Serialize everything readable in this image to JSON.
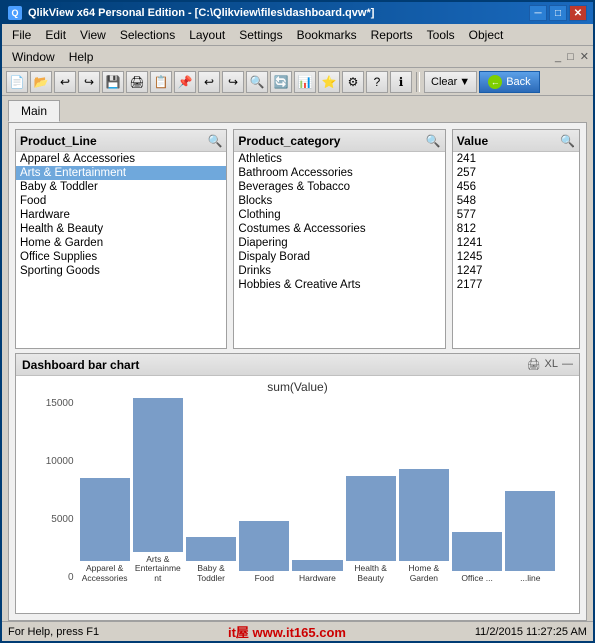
{
  "window": {
    "title": "QlikView x64 Personal Edition - [C:\\Qlikview\\files\\dashboard.qvw*]",
    "icon": "Q"
  },
  "menu": {
    "items": [
      "File",
      "Edit",
      "View",
      "Selections",
      "Layout",
      "Settings",
      "Bookmarks",
      "Reports",
      "Tools",
      "Object",
      "Window",
      "Help"
    ]
  },
  "toolbar": {
    "clear_label": "Clear",
    "back_label": "Back"
  },
  "tabs": [
    {
      "label": "Main",
      "active": true
    }
  ],
  "listboxes": [
    {
      "title": "Product_Line",
      "items": [
        {
          "label": "Apparel & Accessories",
          "state": "normal"
        },
        {
          "label": "Arts & Entertainment",
          "state": "selected"
        },
        {
          "label": "Baby & Toddler",
          "state": "normal"
        },
        {
          "label": "Food",
          "state": "normal"
        },
        {
          "label": "Hardware",
          "state": "normal"
        },
        {
          "label": "Health & Beauty",
          "state": "normal"
        },
        {
          "label": "Home & Garden",
          "state": "normal"
        },
        {
          "label": "Office Supplies",
          "state": "normal"
        },
        {
          "label": "Sporting Goods",
          "state": "normal"
        }
      ]
    },
    {
      "title": "Product_category",
      "items": [
        {
          "label": "Athletics",
          "state": "normal"
        },
        {
          "label": "Bathroom Accessories",
          "state": "normal"
        },
        {
          "label": "Beverages & Tobacco",
          "state": "normal"
        },
        {
          "label": "Blocks",
          "state": "normal"
        },
        {
          "label": "Clothing",
          "state": "normal"
        },
        {
          "label": "Costumes & Accessories",
          "state": "normal"
        },
        {
          "label": "Diapering",
          "state": "normal"
        },
        {
          "label": "Dispaly Borad",
          "state": "normal"
        },
        {
          "label": "Drinks",
          "state": "normal"
        },
        {
          "label": "Hobbies & Creative Arts",
          "state": "normal"
        }
      ]
    },
    {
      "title": "Value",
      "items": [
        {
          "label": "241",
          "state": "normal"
        },
        {
          "label": "257",
          "state": "normal"
        },
        {
          "label": "456",
          "state": "normal"
        },
        {
          "label": "548",
          "state": "normal"
        },
        {
          "label": "577",
          "state": "normal"
        },
        {
          "label": "812",
          "state": "normal"
        },
        {
          "label": "1241",
          "state": "normal"
        },
        {
          "label": "1245",
          "state": "normal"
        },
        {
          "label": "1247",
          "state": "normal"
        },
        {
          "label": "2177",
          "state": "normal"
        }
      ]
    }
  ],
  "chart": {
    "title": "Dashboard bar chart",
    "ylabel": "sum(Value)",
    "y_labels": [
      "15000",
      "10000",
      "5000",
      "0"
    ],
    "bars": [
      {
        "label": "Apparel &\nAccessories",
        "value": 6800,
        "max": 15000
      },
      {
        "label": "Arts &\nEntertainment",
        "value": 15000,
        "max": 15000
      },
      {
        "label": "Baby & Toddler",
        "value": 2000,
        "max": 15000
      },
      {
        "label": "Food",
        "value": 4000,
        "max": 15000
      },
      {
        "label": "Hardware",
        "value": 900,
        "max": 15000
      },
      {
        "label": "Health & Beauty",
        "value": 6900,
        "max": 15000
      },
      {
        "label": "Home & Garden",
        "value": 7500,
        "max": 15000
      },
      {
        "label": "Office\n...",
        "value": 3200,
        "max": 15000
      },
      {
        "label": "...line",
        "value": 6500,
        "max": 15000
      }
    ]
  },
  "status_bar": {
    "help_text": "For Help, press F1",
    "timestamp": "11/2/2015 11:27:25 AM",
    "watermark": "it屋    www.it165.com"
  }
}
